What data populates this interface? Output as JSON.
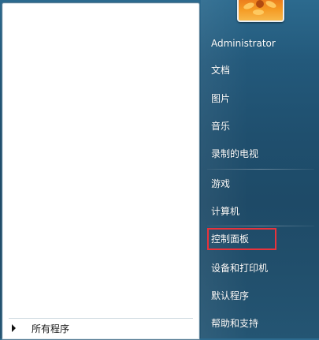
{
  "user": {
    "name": "Administrator",
    "picture_icon": "flower-icon"
  },
  "right_menu": {
    "documents": "文档",
    "pictures": "图片",
    "music": "音乐",
    "recorded_tv": "录制的电视",
    "games": "游戏",
    "computer": "计算机",
    "control_panel": "控制面板",
    "devices_printers": "设备和打印机",
    "default_programs": "默认程序",
    "help_support": "帮助和支持"
  },
  "left_pane": {
    "all_programs": "所有程序"
  },
  "colors": {
    "highlight": "#e8333c",
    "panel_blue": "#1f4f6e"
  }
}
